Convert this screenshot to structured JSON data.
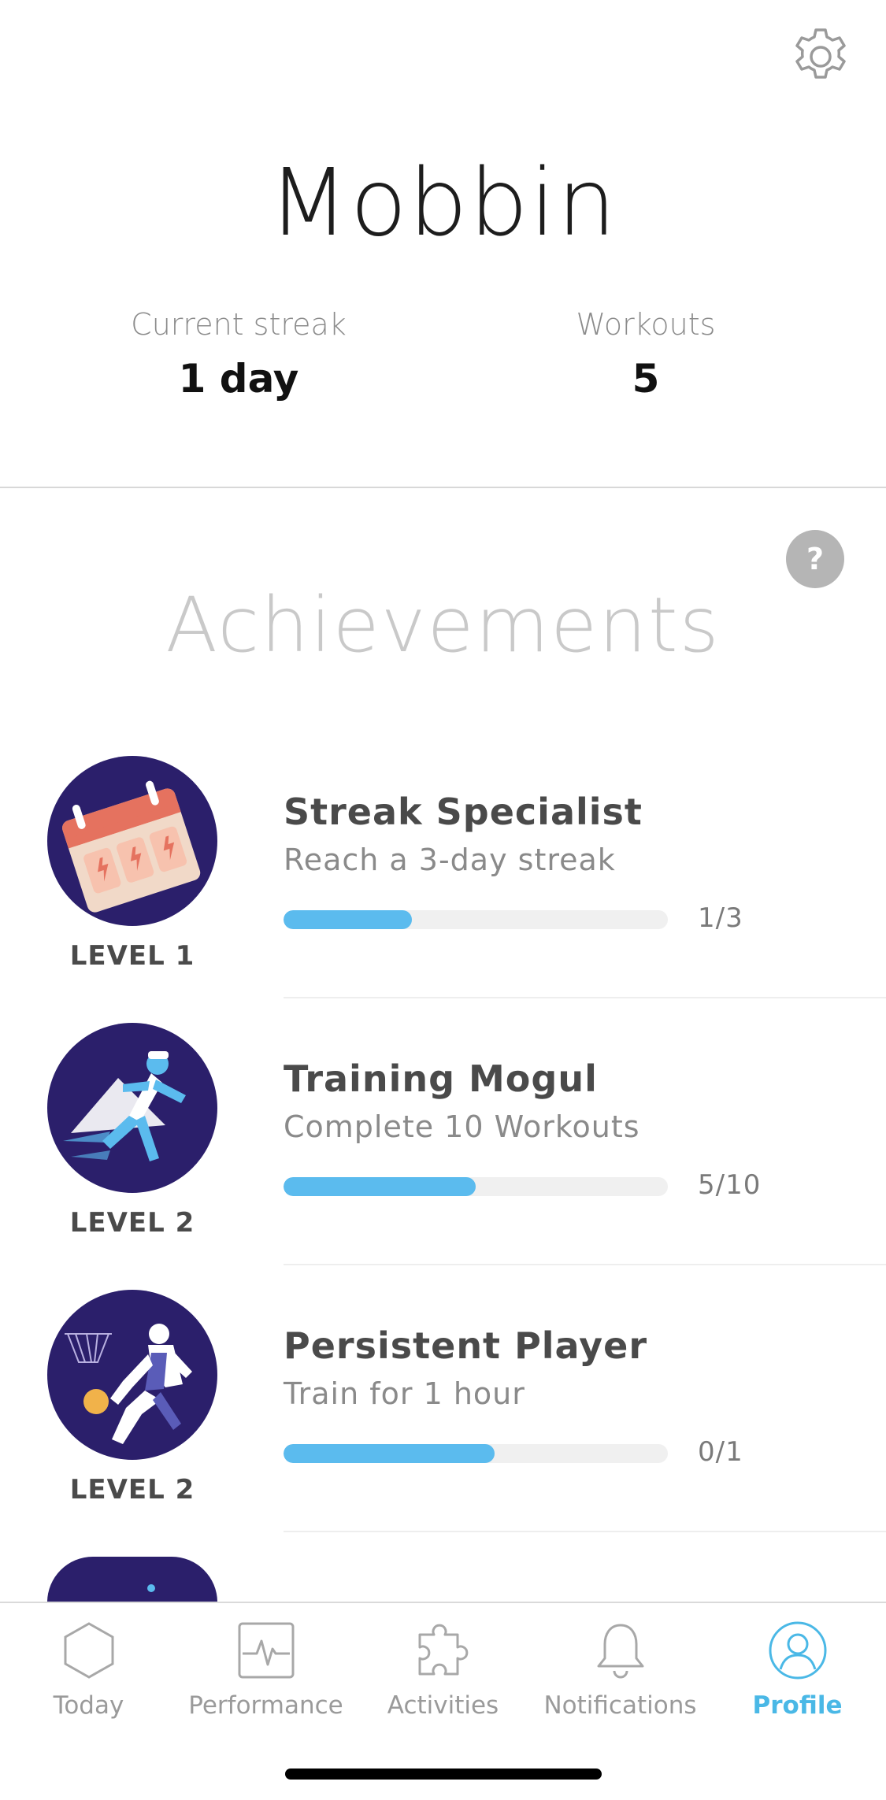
{
  "header": {
    "settings_icon": "gear-icon",
    "user_name": "Mobbin"
  },
  "stats": {
    "streak_label": "Current streak",
    "streak_value": "1 day",
    "workouts_label": "Workouts",
    "workouts_value": "5"
  },
  "achievements": {
    "title": "Achievements",
    "help_label": "?",
    "progress_color": "#5bbbee",
    "badge_color": "#2b1f6b",
    "items": [
      {
        "name": "Streak Specialist",
        "description": "Reach a 3-day streak",
        "level": "LEVEL 1",
        "progress_text": "1/3",
        "progress_fraction": 0.333,
        "badge_icon": "calendar-icon"
      },
      {
        "name": "Training Mogul",
        "description": "Complete 10 Workouts",
        "level": "LEVEL 2",
        "progress_text": "5/10",
        "progress_fraction": 0.5,
        "badge_icon": "runner-icon"
      },
      {
        "name": "Persistent Player",
        "description": "Train for 1 hour",
        "level": "LEVEL 2",
        "progress_text": "0/1",
        "progress_fraction": 0.55,
        "badge_icon": "basketball-player-icon"
      }
    ]
  },
  "tabbar": {
    "active_color": "#4ab8e6",
    "tabs": [
      {
        "label": "Today",
        "icon": "hexagon-icon"
      },
      {
        "label": "Performance",
        "icon": "pulse-chart-icon"
      },
      {
        "label": "Activities",
        "icon": "puzzle-icon"
      },
      {
        "label": "Notifications",
        "icon": "bell-icon"
      },
      {
        "label": "Profile",
        "icon": "profile-icon",
        "active": true
      }
    ]
  }
}
